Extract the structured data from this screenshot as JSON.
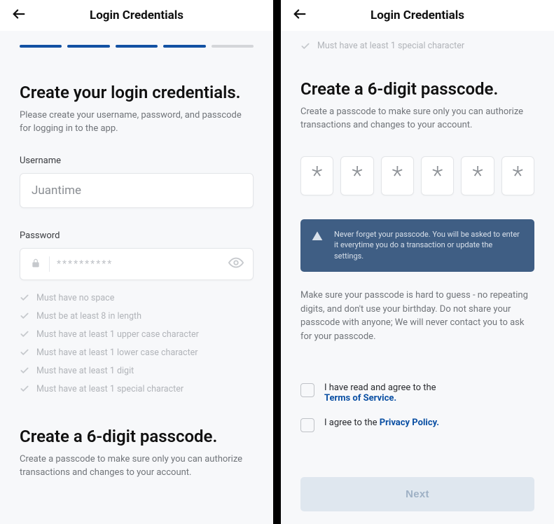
{
  "ui": {
    "back_aria": "Back",
    "header_title": "Login Credentials",
    "progress": {
      "filled": 4,
      "total": 5
    }
  },
  "left": {
    "heading": "Create your login credentials.",
    "sub": "Please create your username, password, and passcode for logging in to the app.",
    "username_label": "Username",
    "username_value": "Juantime",
    "password_label": "Password",
    "password_masked": "**********",
    "rules": [
      "Must have no space",
      "Must be at least 8 in length",
      "Must have at least 1 upper case character",
      "Must have at least 1 lower case character",
      "Must have at least 1 digit",
      "Must have at least 1 special character"
    ],
    "pass_heading": "Create a 6-digit passcode.",
    "pass_sub": "Create a passcode to make sure only you can authorize transactions and changes to your account."
  },
  "right": {
    "top_rule": "Must have at least 1 special character",
    "heading": "Create a 6-digit passcode.",
    "sub": "Create a passcode to make sure only you can authorize transactions and changes to your account.",
    "pin_glyph": "*",
    "info": "Never forget your passcode. You will be asked to enter it everytime you do a transaction or update the settings.",
    "tip": "Make sure your passcode is hard to guess - no repeating digits, and don't use your birthday. Do not share your passcode with anyone; We will never contact you to ask for your passcode.",
    "tos_pre": "I have read and agree to the ",
    "tos_link": "Terms of Service.",
    "pp_pre": "I agree to the ",
    "pp_link": "Privacy Policy.",
    "next_label": "Next"
  }
}
